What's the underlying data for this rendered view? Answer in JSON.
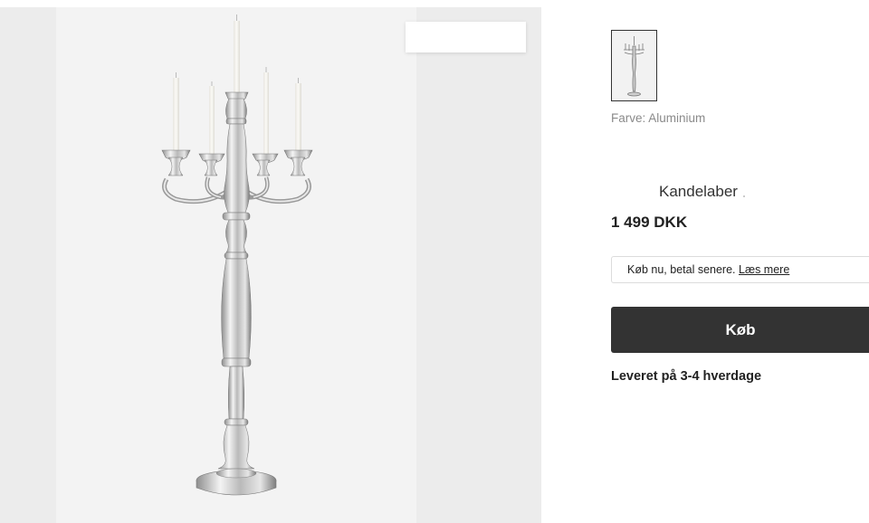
{
  "product": {
    "title": "Kandelaber",
    "price": "1 499 DKK",
    "color_label": "Farve: Aluminium",
    "delivery": "Leveret på 3-4 hverdage"
  },
  "finance": {
    "text": "Køb nu, betal senere.",
    "link_label": "Læs mere"
  },
  "actions": {
    "buy_label": "Køb"
  },
  "gallery": {
    "image_icon": "candelabra-image",
    "thumbnail_icon": "candelabra-thumbnail"
  },
  "colors": {
    "button_bg": "#333333",
    "button_text": "#ffffff",
    "gallery_bg": "#efefef",
    "muted_text": "#8a8a8a"
  }
}
